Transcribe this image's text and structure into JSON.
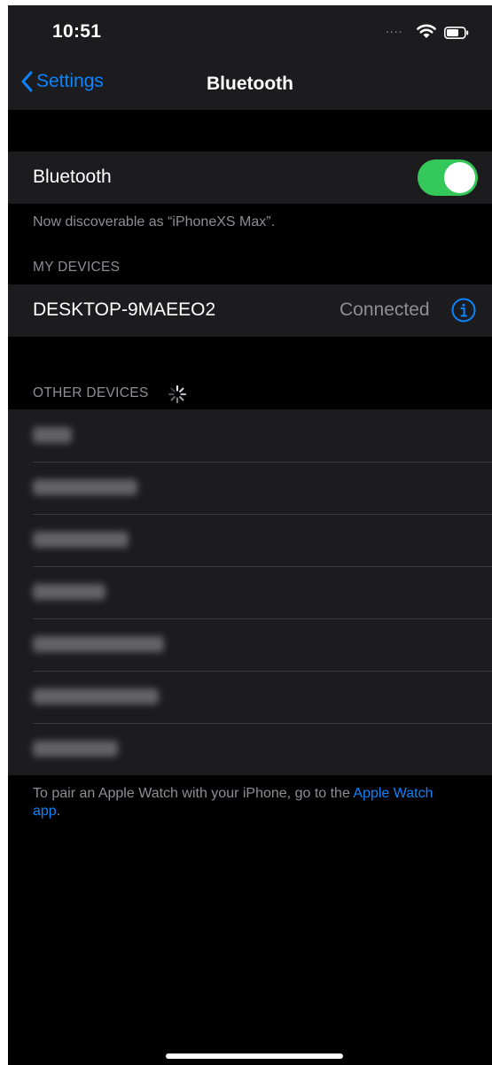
{
  "status": {
    "time": "10:51",
    "signal_dots": "....",
    "icons": [
      "wifi-icon",
      "battery-icon"
    ]
  },
  "nav": {
    "back_label": "Settings",
    "title": "Bluetooth"
  },
  "bluetooth": {
    "label": "Bluetooth",
    "enabled": true,
    "discoverable_note": "Now discoverable as “iPhoneXS Max”."
  },
  "my_devices": {
    "header": "MY DEVICES",
    "items": [
      {
        "name": "DESKTOP-9MAEEO2",
        "status": "Connected"
      }
    ]
  },
  "other_devices": {
    "header": "OTHER DEVICES",
    "searching": true,
    "count_shown": 7,
    "names_obscured": true
  },
  "footer": {
    "text": "To pair an Apple Watch with your iPhone, go to the ",
    "link": "Apple Watch app",
    "end": "."
  },
  "colors": {
    "accent": "#0a84ff",
    "toggle_on": "#34c759",
    "background": "#000000",
    "cell": "#1c1c1e",
    "secondary_text": "#8e8e93"
  }
}
